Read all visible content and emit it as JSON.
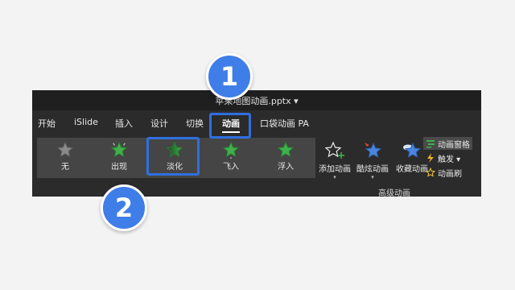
{
  "window": {
    "title": "苹果地图动画.pptx ▾"
  },
  "tabs": [
    {
      "label": "开始"
    },
    {
      "label": "iSlide"
    },
    {
      "label": "插入"
    },
    {
      "label": "设计"
    },
    {
      "label": "切换"
    },
    {
      "label": "动画",
      "active": true
    },
    {
      "label": "口袋动画 PA"
    }
  ],
  "animations": [
    {
      "label": "无",
      "color": "#8a8a8a"
    },
    {
      "label": "出现",
      "color": "#3fb04a"
    },
    {
      "label": "淡化",
      "color": "#3fb04a",
      "selected": true
    },
    {
      "label": "飞入",
      "color": "#3fb04a"
    },
    {
      "label": "浮入",
      "color": "#3fb04a"
    }
  ],
  "advanced": {
    "add_animation": "添加动画",
    "cool_animation": "酷炫动画",
    "favorite_animation": "收藏动画",
    "pane": "动画窗格",
    "trigger": "触发 ▾",
    "painter": "动画刷",
    "group_label": "高级动画"
  },
  "badges": {
    "one": "1",
    "two": "2"
  },
  "colors": {
    "highlight": "#2f6fe0",
    "badge": "#3f7de8",
    "star_green": "#3fb04a"
  }
}
